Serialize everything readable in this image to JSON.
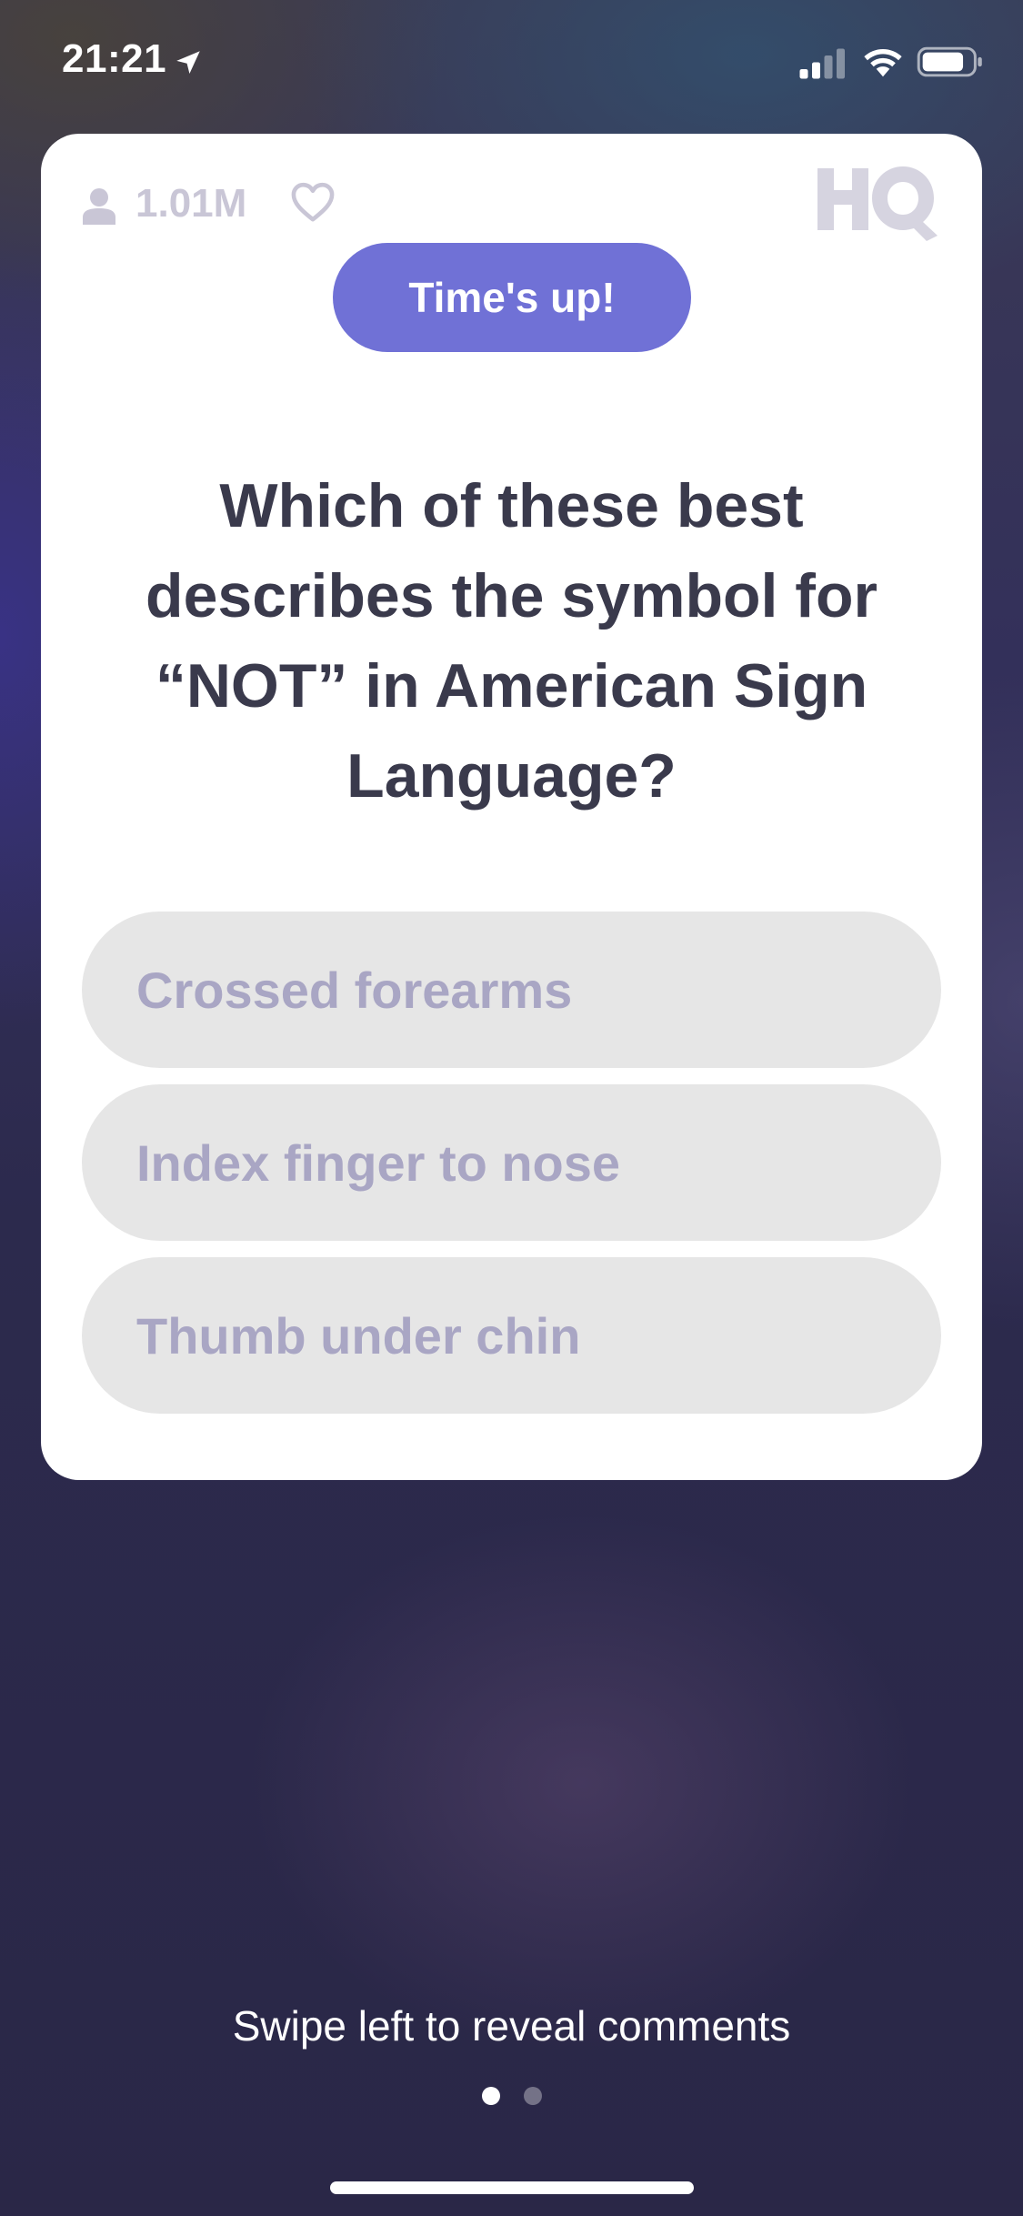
{
  "status_bar": {
    "time": "21:21",
    "icons": [
      "location-arrow-icon",
      "cellular-signal-icon",
      "wifi-icon",
      "battery-icon"
    ]
  },
  "card": {
    "viewer_count": "1.01M",
    "viewer_icon": "person-icon",
    "like_icon": "heart-icon",
    "logo": "HQ",
    "timer_label": "Time's up!",
    "timer_color": "#7071d6",
    "question": "Which of these best describes the symbol for “NOT” in American Sign Language?",
    "answers": [
      {
        "label": "Crossed forearms"
      },
      {
        "label": "Index finger to nose"
      },
      {
        "label": "Thumb under chin"
      }
    ]
  },
  "footer": {
    "swipe_hint": "Swipe left to reveal comments",
    "page_indicator": {
      "current": 1,
      "total": 2
    }
  }
}
